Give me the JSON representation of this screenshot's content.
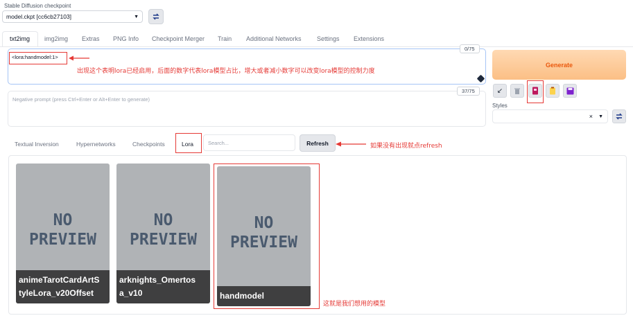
{
  "checkpoint": {
    "label": "Stable Diffusion checkpoint",
    "value": "model.ckpt [cc6cb27103]"
  },
  "tabs": [
    "txt2img",
    "img2img",
    "Extras",
    "PNG Info",
    "Checkpoint Merger",
    "Train",
    "Additional Networks",
    "Settings",
    "Extensions"
  ],
  "prompt": {
    "value": "<lora:handmodel:1>",
    "token_count": "0/75"
  },
  "negative_prompt": {
    "placeholder": "Negative prompt (press Ctrl+Enter or Alt+Enter to generate)",
    "token_count": "37/75"
  },
  "generate_label": "Generate",
  "toolbar": {
    "icons": [
      "arrow-icon",
      "trash-icon",
      "lora-card-icon",
      "clipboard-icon",
      "save-icon"
    ]
  },
  "styles": {
    "label": "Styles",
    "clear": "×"
  },
  "networks": {
    "tabs": [
      "Textual Inversion",
      "Hypernetworks",
      "Checkpoints",
      "Lora"
    ],
    "search_placeholder": "Search...",
    "refresh_label": "Refresh"
  },
  "cards": [
    {
      "preview_line1": "NO",
      "preview_line2": "PREVIEW",
      "title_line1": "animeTarotCardArtS",
      "title_line2": "tyleLora_v20Offset"
    },
    {
      "preview_line1": "NO",
      "preview_line2": "PREVIEW",
      "title_line1": "arknights_Omertos",
      "title_line2": "a_v10"
    },
    {
      "preview_line1": "NO",
      "preview_line2": "PREVIEW",
      "title_line1": "handmodel",
      "title_line2": ""
    }
  ],
  "annotations": {
    "prompt_note": "出现这个表明lora已经启用，后面的数字代表lora模型占比，增大或者减小数字可以改变lora模型的控制力度",
    "refresh_note": "如果没有出现就点refresh",
    "card_note": "这就是我们想用的模型"
  },
  "colors": {
    "accent": "#e53935",
    "generate_text": "#ea580c",
    "generate_bg": "#fbbf85"
  }
}
